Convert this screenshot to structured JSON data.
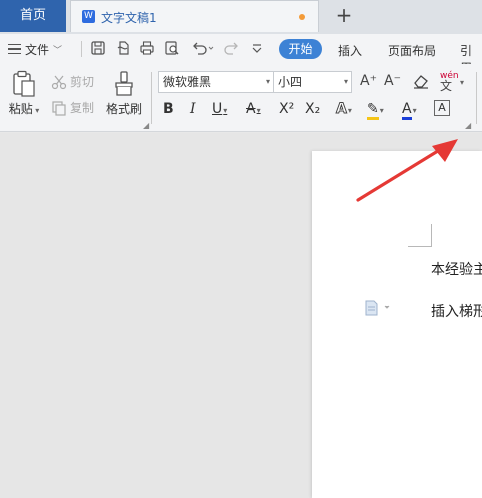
{
  "tabs": {
    "home": "首页",
    "document_title": "文字文稿1",
    "new_tab": "+"
  },
  "menu": {
    "file": "文件",
    "tabs": [
      {
        "label": "开始",
        "active": true
      },
      {
        "label": "插入",
        "active": false
      },
      {
        "label": "页面布局",
        "active": false
      },
      {
        "label": "引用",
        "active": false
      }
    ]
  },
  "clipboard": {
    "paste": "粘贴",
    "cut": "剪切",
    "copy": "复制",
    "format_painter": "格式刷"
  },
  "font": {
    "family": "微软雅黑",
    "size": "小四",
    "grow": "A⁺",
    "shrink": "A⁻",
    "clear": "◇",
    "phonetic": "wén",
    "phonetic_char": "文",
    "bold": "B",
    "italic": "I",
    "underline": "U",
    "strikethrough": "A",
    "superscript": "X²",
    "subscript": "X₂",
    "text_effect": "A",
    "highlight": "✎",
    "font_color": "A",
    "char_border": "A"
  },
  "colors": {
    "accent": "#3d82d5",
    "home_tab": "#2f64ad",
    "highlight": "#f5c518",
    "font_color": "#1a3ed8",
    "arrow": "#e53935",
    "modified_dot": "#f39b38"
  },
  "document": {
    "lines": [
      "本经验主",
      "插入梯形"
    ]
  }
}
